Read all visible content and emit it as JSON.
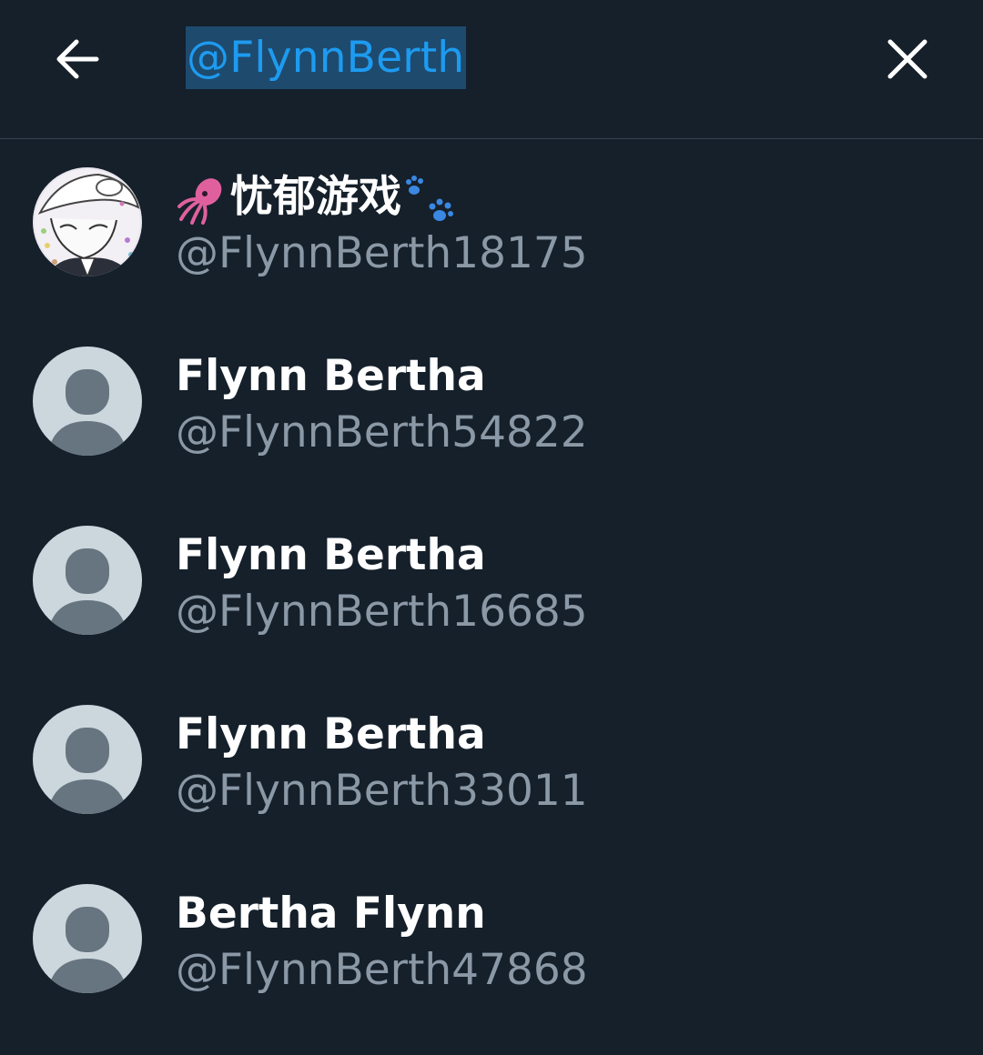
{
  "search": {
    "query": "@FlynnBerth"
  },
  "icons": {
    "back": "arrow-left-icon",
    "close": "close-x-icon",
    "default_avatar": "default-profile-icon",
    "squid": "squid-emoji",
    "paw": "paw-prints-emoji"
  },
  "colors": {
    "background": "#15202b",
    "accent": "#1d9bf0",
    "selection": "#1e4a6e",
    "secondary_text": "#8b98a5",
    "divider": "#38444d",
    "avatar_bg": "#ccd6dd",
    "avatar_silhouette": "#66757f"
  },
  "results": [
    {
      "name": "忧郁游戏",
      "handle": "@FlynnBerth18175"
    },
    {
      "name": "Flynn Bertha",
      "handle": "@FlynnBerth54822"
    },
    {
      "name": "Flynn Bertha",
      "handle": "@FlynnBerth16685"
    },
    {
      "name": "Flynn Bertha",
      "handle": "@FlynnBerth33011"
    },
    {
      "name": "Bertha Flynn",
      "handle": "@FlynnBerth47868"
    }
  ]
}
